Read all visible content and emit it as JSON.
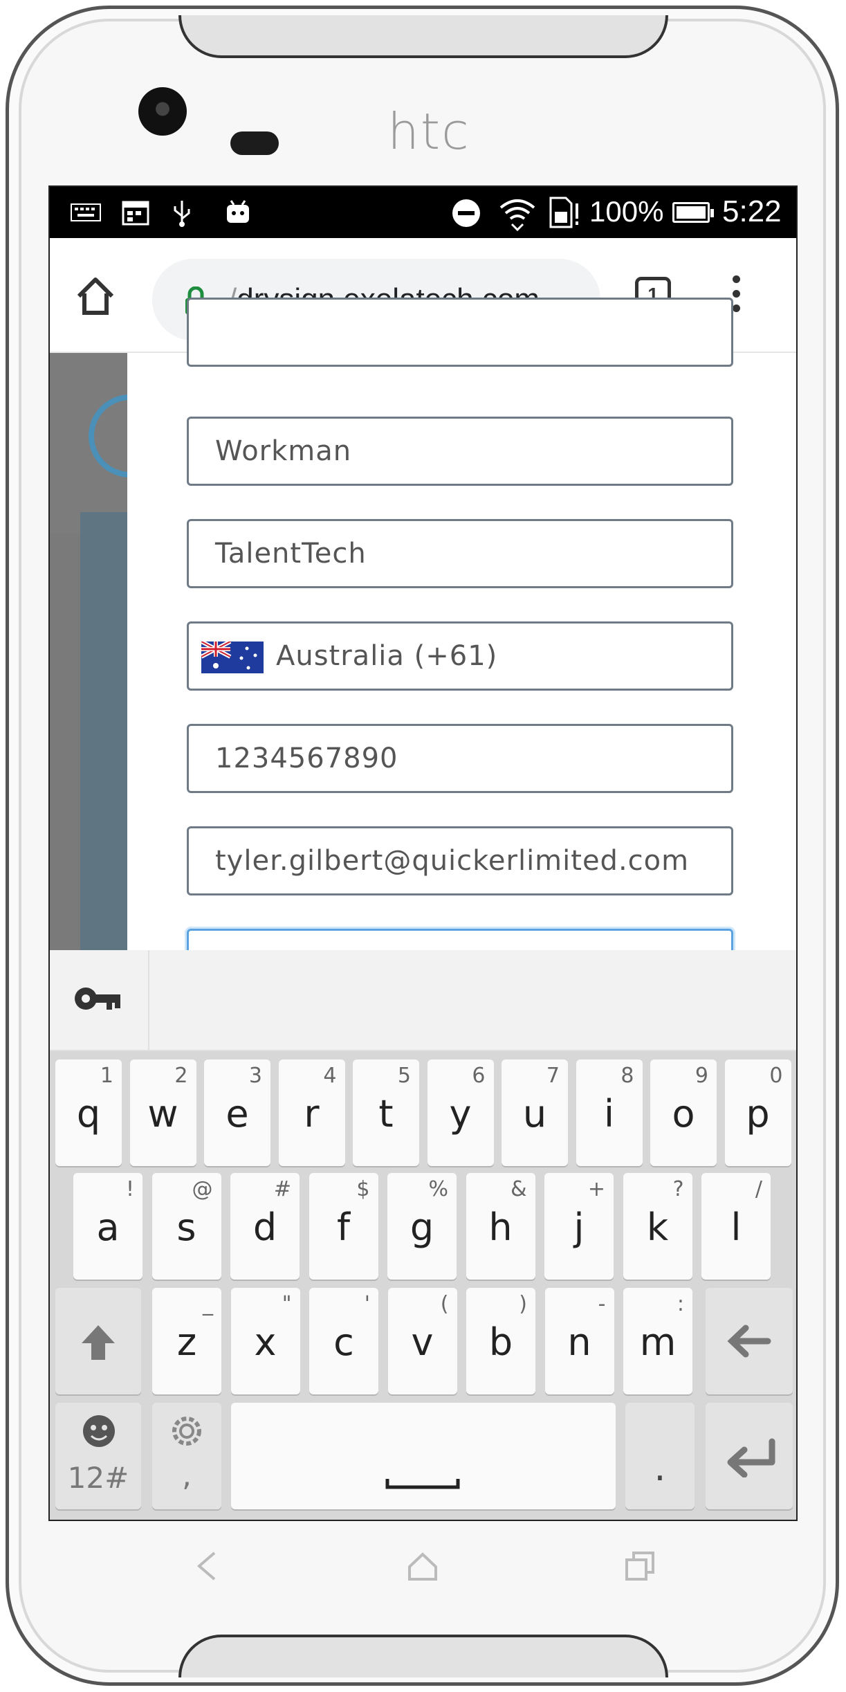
{
  "device": {
    "brand": "htc"
  },
  "status_bar": {
    "battery": "100%",
    "time": "5:22"
  },
  "browser": {
    "url_prefix": "/",
    "url_host": "drysign.exelatech.com",
    "tab_count": "1"
  },
  "form": {
    "last_name": "Workman",
    "company": "TalentTech",
    "country": "Australia (+61)",
    "phone": "1234567890",
    "email": "tyler.gilbert@quickerlimited.com",
    "password_mask": "•••••••••"
  },
  "keyboard": {
    "row1": [
      {
        "k": "q",
        "h": "1"
      },
      {
        "k": "w",
        "h": "2"
      },
      {
        "k": "e",
        "h": "3"
      },
      {
        "k": "r",
        "h": "4"
      },
      {
        "k": "t",
        "h": "5"
      },
      {
        "k": "y",
        "h": "6"
      },
      {
        "k": "u",
        "h": "7"
      },
      {
        "k": "i",
        "h": "8"
      },
      {
        "k": "o",
        "h": "9"
      },
      {
        "k": "p",
        "h": "0"
      }
    ],
    "row2": [
      {
        "k": "a",
        "h": "!"
      },
      {
        "k": "s",
        "h": "@"
      },
      {
        "k": "d",
        "h": "#"
      },
      {
        "k": "f",
        "h": "$"
      },
      {
        "k": "g",
        "h": "%"
      },
      {
        "k": "h",
        "h": "&"
      },
      {
        "k": "j",
        "h": "+"
      },
      {
        "k": "k",
        "h": "?"
      },
      {
        "k": "l",
        "h": "/"
      }
    ],
    "row3": [
      {
        "k": "z",
        "h": "_"
      },
      {
        "k": "x",
        "h": "\""
      },
      {
        "k": "c",
        "h": "'"
      },
      {
        "k": "v",
        "h": "("
      },
      {
        "k": "b",
        "h": ")"
      },
      {
        "k": "n",
        "h": "-"
      },
      {
        "k": "m",
        "h": ":"
      }
    ],
    "symbols_label": "12#",
    "comma_label": ",",
    "period_label": "."
  }
}
